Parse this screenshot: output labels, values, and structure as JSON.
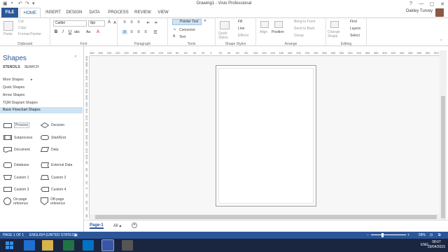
{
  "window": {
    "title": "Drawing1 - Visio Professional",
    "min": "—",
    "max": "▢",
    "close": "✕",
    "help": "?"
  },
  "tabs": [
    "FILE",
    "HOME",
    "INSERT",
    "DESIGN",
    "DATA",
    "PROCESS",
    "REVIEW",
    "VIEW"
  ],
  "user": "Oakley Turvey",
  "ribbon": {
    "clipboard": {
      "paste": "Paste",
      "cut": "Cut",
      "copy": "Copy",
      "format_painter": "Format Painter",
      "label": "Clipboard"
    },
    "font": {
      "face": "Calibri",
      "size": "8pt",
      "label": "Font"
    },
    "paragraph": {
      "label": "Paragraph"
    },
    "tools": {
      "pointer": "Pointer Tool",
      "connector": "Connector",
      "text": "Text",
      "label": "Tools"
    },
    "shape_styles": {
      "quick_styles": "Quick Styles",
      "fill": "Fill",
      "line": "Line",
      "effects": "Effects",
      "label": "Shape Styles"
    },
    "arrange": {
      "align": "Align",
      "position": "Position",
      "bring_front": "Bring to Front",
      "send_back": "Send to Back",
      "group": "Group",
      "label": "Arrange"
    },
    "editing": {
      "change_shape": "Change Shape",
      "find": "Find",
      "layers": "Layers",
      "select": "Select",
      "label": "Editing"
    }
  },
  "shapes_pane": {
    "title": "Shapes",
    "tabs": [
      "STENCILS",
      "SEARCH"
    ],
    "stencils": [
      "More Shapes",
      "Quick Shapes",
      "Arrow Shapes",
      "TQM Diagram Shapes",
      "Basic Flowchart Shapes"
    ],
    "shapes": [
      [
        "Process",
        "Decision"
      ],
      [
        "Subprocess",
        "Start/End"
      ],
      [
        "Document",
        "Data"
      ],
      [
        "Database",
        "External Data"
      ],
      [
        "Custom 1",
        "Custom 2"
      ],
      [
        "Custom 3",
        "Custom 4"
      ],
      [
        "On-page reference",
        "Off-page reference"
      ]
    ]
  },
  "ruler_top": [
    "280",
    "260",
    "240",
    "220",
    "200",
    "180",
    "160",
    "140",
    "120",
    "100",
    "80",
    "60",
    "40",
    "20",
    "0",
    "20",
    "40",
    "60",
    "80",
    "100",
    "120",
    "140",
    "160",
    "180",
    "200",
    "220",
    "240",
    "260",
    "280",
    "300",
    "320",
    "340",
    "360",
    "380",
    "400",
    "420",
    "440",
    "460",
    "480",
    "500",
    "520"
  ],
  "ruler_left": [
    "400",
    "380",
    "360",
    "340",
    "320",
    "300",
    "280",
    "260",
    "240",
    "220",
    "200",
    "180",
    "160",
    "140",
    "120",
    "100",
    "80",
    "60",
    "40",
    "20",
    "0",
    "-20",
    "-40",
    "-60",
    "-80"
  ],
  "page_tabs": {
    "page": "Page-1",
    "all": "All ▴",
    "add": "+"
  },
  "status": {
    "page": "PAGE 1 OF 1",
    "language": "ENGLISH (UNITED STATES)",
    "zoom": "58%"
  },
  "taskbar": {
    "lang": "ENG",
    "time": "08:07",
    "date": "29/04/2015"
  }
}
